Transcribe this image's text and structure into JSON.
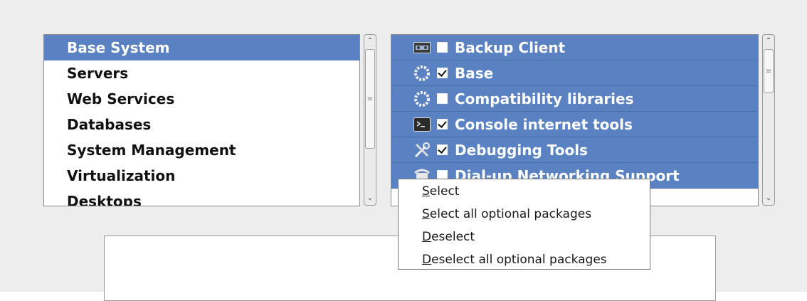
{
  "categories": [
    {
      "label": "Base System",
      "selected": true
    },
    {
      "label": "Servers"
    },
    {
      "label": "Web Services"
    },
    {
      "label": "Databases"
    },
    {
      "label": "System Management"
    },
    {
      "label": "Virtualization"
    },
    {
      "label": "Desktops"
    }
  ],
  "groups": [
    {
      "label": "Backup Client",
      "checked": false,
      "icon": "tape-drive-icon"
    },
    {
      "label": "Base",
      "checked": true,
      "icon": "gear-icon"
    },
    {
      "label": "Compatibility libraries",
      "checked": false,
      "icon": "gear-icon"
    },
    {
      "label": "Console internet tools",
      "checked": true,
      "icon": "terminal-icon"
    },
    {
      "label": "Debugging Tools",
      "checked": true,
      "icon": "tools-icon"
    },
    {
      "label": "Dial-up Networking Support",
      "checked": false,
      "icon": "telephone-icon"
    }
  ],
  "context_menu": {
    "items": [
      {
        "mnemonic": "S",
        "rest": "elect"
      },
      {
        "mnemonic": "S",
        "rest": "elect all optional packages"
      },
      {
        "mnemonic": "D",
        "rest": "eselect"
      },
      {
        "mnemonic": "D",
        "rest": "eselect all optional packages"
      }
    ]
  },
  "colors": {
    "selection": "#5a82c3",
    "background": "#ededed"
  }
}
